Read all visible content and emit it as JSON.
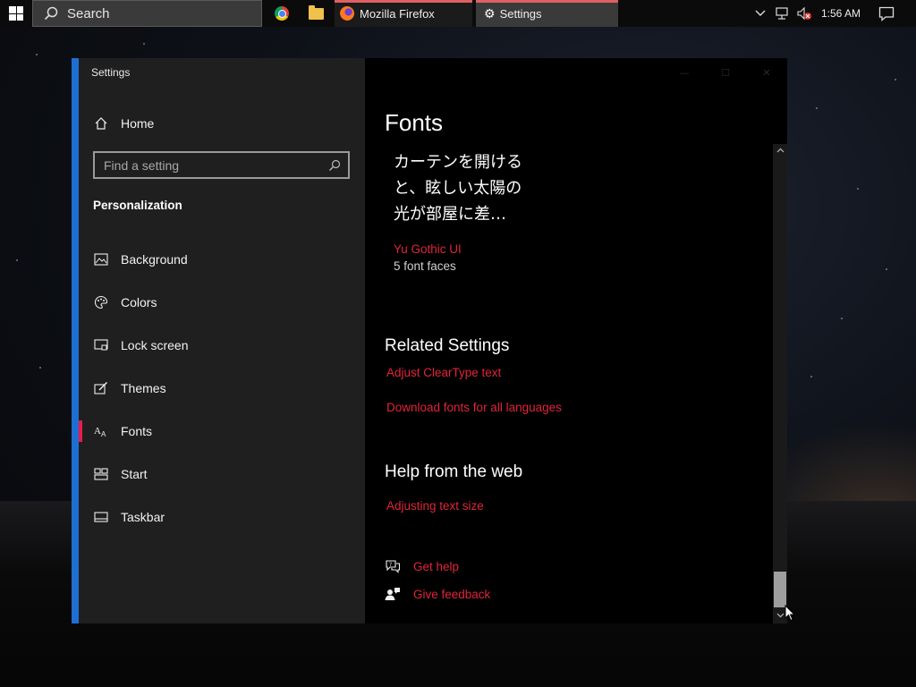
{
  "taskbar": {
    "search_placeholder": "Search",
    "tasks": [
      {
        "label": "Mozilla Firefox",
        "icon": "firefox-icon"
      },
      {
        "label": "Settings",
        "icon": "gear-icon"
      }
    ],
    "pinned": [
      "chrome-icon",
      "file-explorer-icon"
    ],
    "clock": "1:56 AM"
  },
  "window": {
    "title": "Settings",
    "accent_color": "#1e6fd1",
    "link_color": "#e0243a"
  },
  "sidebar": {
    "home_label": "Home",
    "search_placeholder": "Find a setting",
    "section_title": "Personalization",
    "items": [
      {
        "label": "Background",
        "icon": "picture-icon"
      },
      {
        "label": "Colors",
        "icon": "palette-icon"
      },
      {
        "label": "Lock screen",
        "icon": "lock-screen-icon"
      },
      {
        "label": "Themes",
        "icon": "themes-icon"
      },
      {
        "label": "Fonts",
        "icon": "fonts-icon",
        "selected": true
      },
      {
        "label": "Start",
        "icon": "start-icon"
      },
      {
        "label": "Taskbar",
        "icon": "taskbar-icon"
      }
    ]
  },
  "main": {
    "title": "Fonts",
    "font_card": {
      "sample_lines": [
        "カーテンを開ける",
        "と、眩しい太陽の",
        "光が部屋に差…"
      ],
      "name": "Yu Gothic UI",
      "faces": "5 font faces"
    },
    "related": {
      "heading": "Related Settings",
      "links": [
        "Adjust ClearType text",
        "Download fonts for all languages"
      ]
    },
    "help_web": {
      "heading": "Help from the web",
      "links": [
        "Adjusting text size"
      ]
    },
    "support": {
      "get_help": "Get help",
      "give_feedback": "Give feedback"
    }
  }
}
